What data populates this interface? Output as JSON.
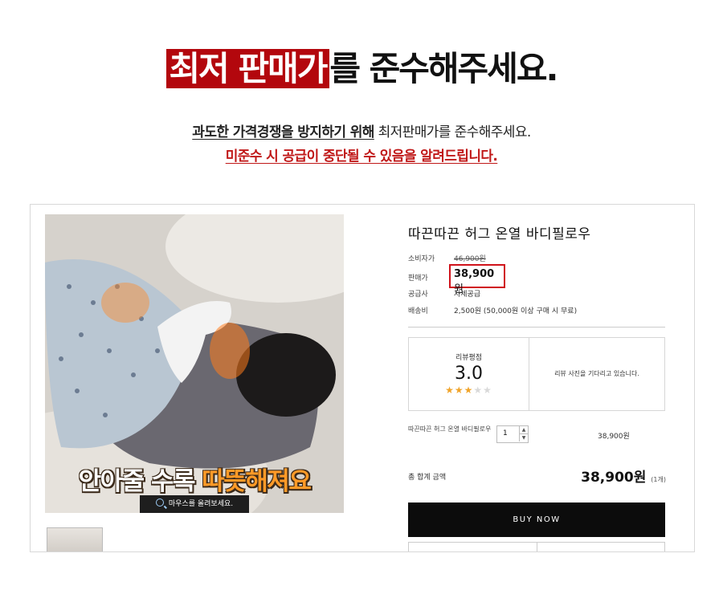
{
  "header": {
    "headline_highlight": "최저 판매가",
    "headline_rest": "를 준수해주세요.",
    "notice_bold": "과도한 가격경쟁을 방지하기 위해",
    "notice_rest": " 최저판매가를 준수해주세요.",
    "warning": "미준수 시 공급이 중단될 수 있음을 알려드립니다."
  },
  "product": {
    "image_caption_part1": "안아줄 수록 ",
    "image_caption_part2": "따뜻해져요",
    "zoom_hint": "마우스를 올려보세요.",
    "title": "따끈따끈 허그 온열 바디필로우",
    "info": {
      "consumer_price_label": "소비자가",
      "consumer_price": "46,900원",
      "sale_price_label": "판매가",
      "sale_price_number": "38,900",
      "sale_price_unit": "원",
      "supplier_label": "공급사",
      "supplier": "자체공급",
      "shipping_label": "배송비",
      "shipping": "2,500원 (50,000원 이상 구매 시 무료)"
    },
    "review": {
      "label": "리뷰평점",
      "score": "3.0",
      "rating": 3,
      "max": 5,
      "note": "리뷰 사진을 기다리고 있습니다."
    },
    "option": {
      "name": "따끈따끈 허그 온열 바디필로우",
      "quantity": "1",
      "price": "38,900원"
    },
    "total": {
      "label": "총 합계 금액",
      "amount": "38,900원",
      "count": "(1개)"
    },
    "buy_label": "BUY NOW"
  },
  "colors": {
    "highlight_red": "#b3070d",
    "warning_red": "#c01818",
    "star": "#f0a42a",
    "buy_button": "#0c0c0c"
  }
}
